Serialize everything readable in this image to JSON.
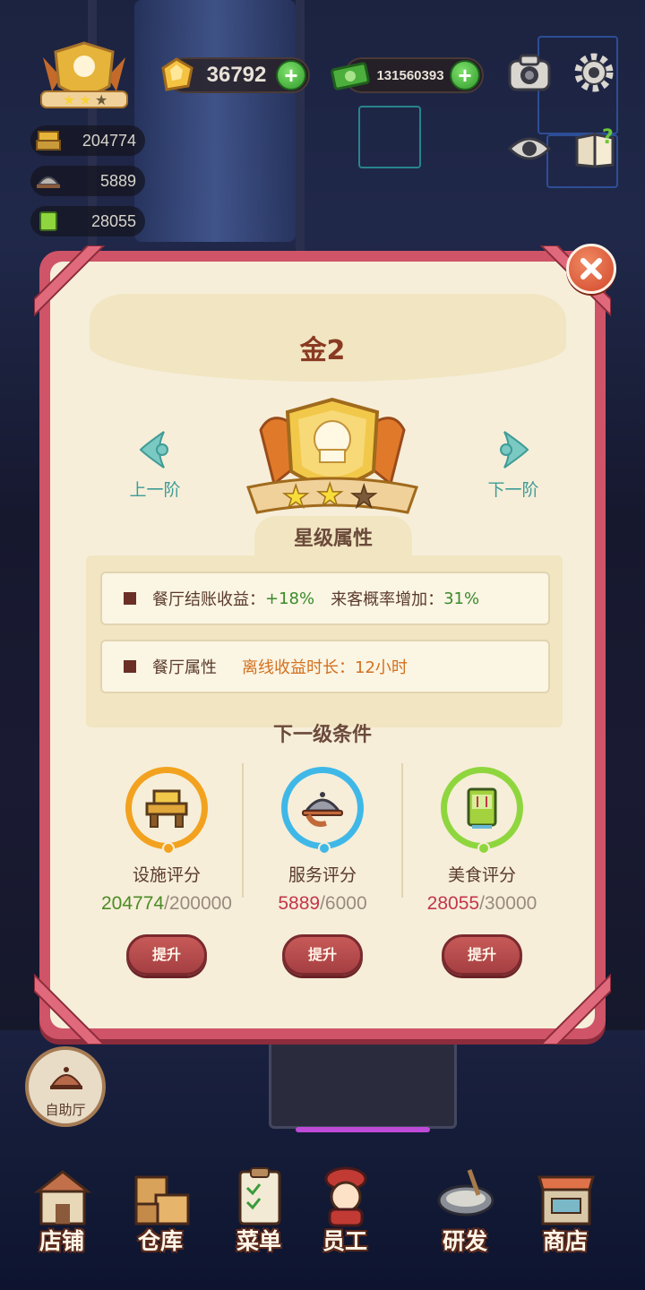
{
  "hud": {
    "gems": "36792",
    "cash": "131560393",
    "stats": [
      {
        "icon": "facility-icon",
        "value": "204774"
      },
      {
        "icon": "service-icon",
        "value": "5889"
      },
      {
        "icon": "food-icon",
        "value": "28055"
      }
    ]
  },
  "modal": {
    "title": "金2",
    "prev_label": "上一阶",
    "next_label": "下一阶",
    "section_title": "星级属性",
    "stars_filled": 2,
    "stars_total": 3,
    "props": [
      {
        "label": "餐厅结账收益：",
        "value1": "+18%",
        "label2": "来客概率增加：",
        "value2": "31%"
      },
      {
        "label": "餐厅属性",
        "value1": "离线收益时长：12小时"
      }
    ],
    "next_title": "下一级条件",
    "requirements": [
      {
        "name": "设施评分",
        "current": "204774",
        "goal": "/200000",
        "icon": "pedestal-icon",
        "ring_color": "#f2a21e",
        "button": "提升"
      },
      {
        "name": "服务评分",
        "current": "5889",
        "goal": "/6000",
        "icon": "serving-tray-icon",
        "ring_color": "#3fb8e8",
        "button": "提升"
      },
      {
        "name": "美食评分",
        "current": "28055",
        "goal": "/30000",
        "icon": "recipe-book-icon",
        "ring_color": "#8fd63e",
        "button": "提升"
      }
    ]
  },
  "buffet": {
    "label": "自助厅"
  },
  "bottom_nav": [
    {
      "label": "店铺",
      "icon": "shop-building-icon"
    },
    {
      "label": "仓库",
      "icon": "warehouse-boxes-icon"
    },
    {
      "label": "菜单",
      "icon": "menu-clipboard-icon"
    },
    {
      "label": "员工",
      "icon": "staff-chef-icon"
    },
    {
      "label": "研发",
      "icon": "cooking-pot-icon"
    },
    {
      "label": "商店",
      "icon": "store-icon"
    }
  ]
}
